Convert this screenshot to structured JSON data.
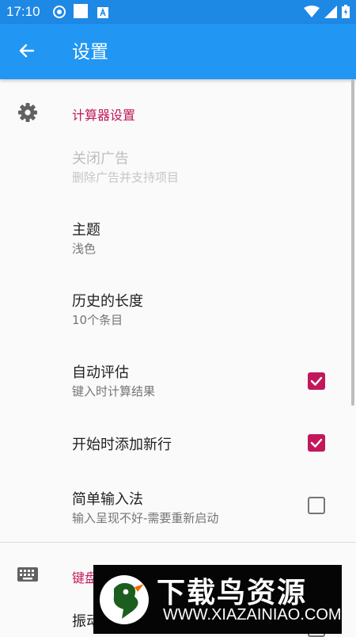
{
  "status_bar": {
    "time": "17:10",
    "icons": [
      "sync-circle-icon",
      "white-square-icon",
      "a-box-icon",
      "wifi-icon",
      "signal-icon",
      "battery-icon"
    ]
  },
  "app_bar": {
    "title": "设置",
    "back_icon": "arrow-left-icon"
  },
  "sections": [
    {
      "header": "计算器设置",
      "icon": "gear-icon",
      "items": [
        {
          "title": "关闭广告",
          "summary": "删除广告并支持项目",
          "enabled": false
        },
        {
          "title": "主题",
          "summary": "浅色"
        },
        {
          "title": "历史的长度",
          "summary": "10个条目"
        },
        {
          "title": "自动评估",
          "summary": "键入时计算结果",
          "checked": true
        },
        {
          "title": "开始时添加新行",
          "checked": true
        },
        {
          "title": "简单输入法",
          "summary": "输入呈现不好-需要重新启动",
          "checked": false
        }
      ]
    },
    {
      "header": "键盘",
      "icon": "keyboard-icon",
      "items": [
        {
          "title": "振动"
        }
      ]
    }
  ],
  "watermark": {
    "title": "下载鸟资源",
    "url": "WWW.XIAZAINIAO.COM"
  },
  "colors": {
    "status_bar": "#1e88e5",
    "app_bar": "#2196f3",
    "accent": "#c2185b",
    "background": "#fafafa"
  }
}
